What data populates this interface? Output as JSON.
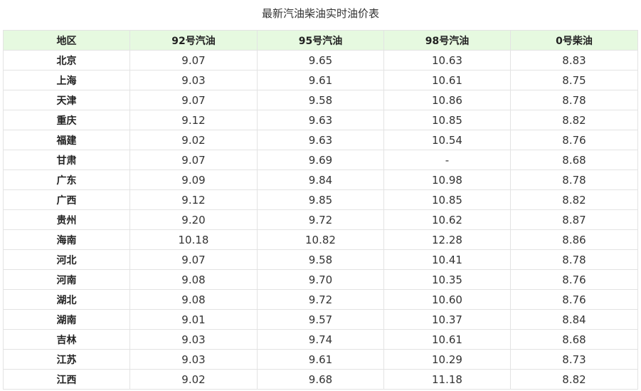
{
  "page": {
    "title": "最新汽油柴油实时油价表"
  },
  "table": {
    "headers": [
      "地区",
      "92号汽油",
      "95号汽油",
      "98号汽油",
      "0号柴油"
    ],
    "rows": [
      [
        "北京",
        "9.07",
        "9.65",
        "10.63",
        "8.83"
      ],
      [
        "上海",
        "9.03",
        "9.61",
        "10.61",
        "8.75"
      ],
      [
        "天津",
        "9.07",
        "9.58",
        "10.86",
        "8.78"
      ],
      [
        "重庆",
        "9.12",
        "9.63",
        "10.85",
        "8.82"
      ],
      [
        "福建",
        "9.02",
        "9.63",
        "10.54",
        "8.76"
      ],
      [
        "甘肃",
        "9.07",
        "9.69",
        "-",
        "8.68"
      ],
      [
        "广东",
        "9.09",
        "9.84",
        "10.98",
        "8.78"
      ],
      [
        "广西",
        "9.12",
        "9.85",
        "10.85",
        "8.82"
      ],
      [
        "贵州",
        "9.20",
        "9.72",
        "10.62",
        "8.87"
      ],
      [
        "海南",
        "10.18",
        "10.82",
        "12.28",
        "8.86"
      ],
      [
        "河北",
        "9.07",
        "9.58",
        "10.41",
        "8.78"
      ],
      [
        "河南",
        "9.08",
        "9.70",
        "10.35",
        "8.76"
      ],
      [
        "湖北",
        "9.08",
        "9.72",
        "10.60",
        "8.76"
      ],
      [
        "湖南",
        "9.01",
        "9.57",
        "10.37",
        "8.84"
      ],
      [
        "吉林",
        "9.03",
        "9.74",
        "10.61",
        "8.68"
      ],
      [
        "江苏",
        "9.03",
        "9.61",
        "10.29",
        "8.73"
      ],
      [
        "江西",
        "9.02",
        "9.68",
        "11.18",
        "8.82"
      ]
    ]
  },
  "colors": {
    "header_bg": "#e6f9e0",
    "border": "#e3e3e3",
    "text": "#333333"
  }
}
